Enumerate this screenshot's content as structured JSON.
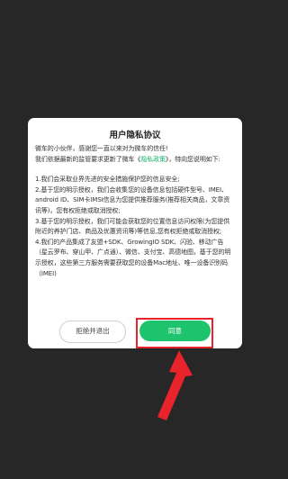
{
  "dialog": {
    "title": "用户隐私协议",
    "intro_line1": "微车的小伙伴，感谢您一直以来对为微车的信任!",
    "intro_line2_pre": "我们依据最新的监管要求更新了微车《",
    "intro_link": "隐私政策",
    "intro_line2_post": "》，特向您说明如下:",
    "items": [
      "1.我们会采取业界先进的安全措施保护您的信息安全;",
      "2.基于您的明示授权，我们会收集您的设备信息包括硬件型号、IMEI、android ID、SIM卡IMSI信息为您提供推荐服务(推荐相关商品，文章资讯等)，您有权拒绝或取消授权;",
      "3.基于您的明示授权，我们可能会获取您的位置信息访问权限(为您提供附近的养护门店、商品及优惠资讯等)等信息,您有权拒绝或取消授权;",
      "4.我们的产品集成了友盟+SDK、GrowingIO SDK、闪验、移动广告（星云罗布、穿山甲、广点通）、微信、支付宝、高德地图，基于您的明示授权，这些第三方服务需要获取您的设备Mac地址、唯一设备识别码（IMEI)"
    ]
  },
  "buttons": {
    "reject_label": "拒绝并退出",
    "agree_label": "同意"
  },
  "colors": {
    "background": "#272727",
    "accent_green": "#1ec36e",
    "annotation_red": "#e8232b"
  }
}
